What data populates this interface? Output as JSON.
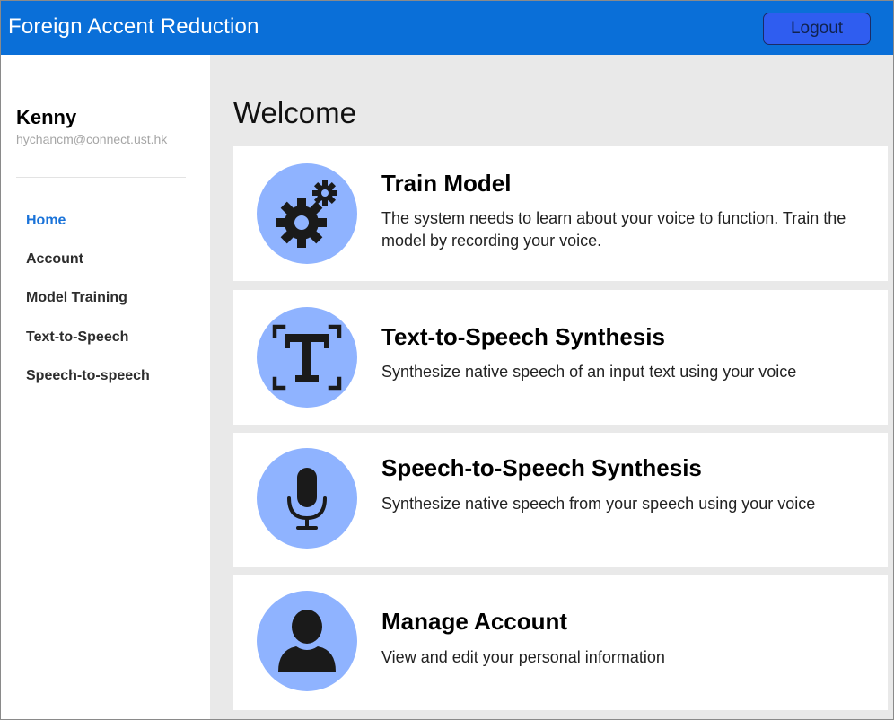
{
  "header": {
    "app_title": "Foreign Accent Reduction",
    "logout_label": "Logout",
    "accent_color": "#0a6fd8"
  },
  "user": {
    "name": "Kenny",
    "email": "hychancm@connect.ust.hk"
  },
  "sidebar": {
    "items": [
      {
        "label": "Home",
        "active": true
      },
      {
        "label": "Account",
        "active": false
      },
      {
        "label": "Model Training",
        "active": false
      },
      {
        "label": "Text-to-Speech",
        "active": false
      },
      {
        "label": "Speech-to-speech",
        "active": false
      }
    ]
  },
  "main": {
    "heading": "Welcome",
    "cards": [
      {
        "icon": "gears-icon",
        "title": "Train Model",
        "description": "The system needs to learn about your voice to function. Train the model by recording your voice."
      },
      {
        "icon": "text-frame-icon",
        "title": "Text-to-Speech Synthesis",
        "description": "Synthesize native speech of an input text using your voice"
      },
      {
        "icon": "microphone-icon",
        "title": "Speech-to-Speech Synthesis",
        "description": "Synthesize native speech from your speech using your voice"
      },
      {
        "icon": "user-icon",
        "title": "Manage Account",
        "description": "View and edit your personal information"
      }
    ],
    "icon_circle_color": "#8fb3ff"
  }
}
